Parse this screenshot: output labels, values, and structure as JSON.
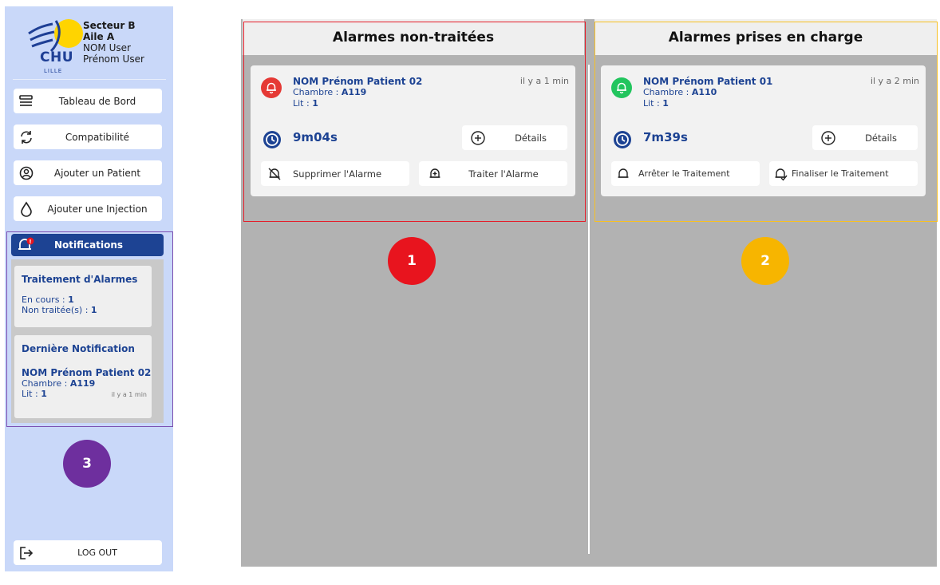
{
  "sidebar": {
    "sector": "Secteur B",
    "wing": "Aile A",
    "brand": "CHU",
    "brand_sub": "LILLE",
    "user_last": "NOM User",
    "user_first": "Prénom User",
    "nav": [
      {
        "label": "Tableau de Bord",
        "icon": "dashboard-icon"
      },
      {
        "label": "Compatibilité",
        "icon": "refresh-icon"
      },
      {
        "label": "Ajouter un Patient",
        "icon": "user-circle-icon"
      },
      {
        "label": "Ajouter une Injection",
        "icon": "drop-icon"
      }
    ],
    "notifications": {
      "label": "Notifications",
      "icon": "bell-alert-icon",
      "treatment": {
        "title": "Traitement d'Alarmes",
        "in_progress_label": "En cours : ",
        "in_progress": "1",
        "untreated_label": "Non traitée(s) : ",
        "untreated": "1"
      },
      "last": {
        "title": "Dernière Notification",
        "patient": "NOM Prénom Patient 02",
        "room_label": "Chambre : ",
        "room": "A119",
        "bed_label": "Lit : ",
        "bed": "1",
        "time": "il y a 1 min"
      }
    },
    "logout": "LOG OUT",
    "badge": "3"
  },
  "columns": [
    {
      "title": "Alarmes non-traitées",
      "badge": "1",
      "alarm": {
        "patient": "NOM Prénom Patient 02",
        "room_label": "Chambre : ",
        "room": "A119",
        "bed_label": "Lit : ",
        "bed": "1",
        "time": "il y a 1 min",
        "duration": "9m04s",
        "details": "Détails",
        "action1": "Supprimer l'Alarme",
        "action2": "Traiter l'Alarme"
      }
    },
    {
      "title": "Alarmes prises en charge",
      "badge": "2",
      "alarm": {
        "patient": "NOM Prénom Patient 01",
        "room_label": "Chambre : ",
        "room": "A110",
        "bed_label": "Lit : ",
        "bed": "1",
        "time": "il y a 2 min",
        "duration": "7m39s",
        "details": "Détails",
        "action1": "Arrêter le Traitement",
        "action2": "Finaliser le Traitement"
      }
    }
  ],
  "colors": {
    "navy": "#1d4393",
    "sidebar_bg": "#c9d8f9",
    "alarm_red": "#e53935",
    "alarm_green": "#22c55e",
    "badge_red": "#e8141e",
    "badge_yellow": "#f7b500",
    "badge_purple": "#6e2f9e"
  }
}
